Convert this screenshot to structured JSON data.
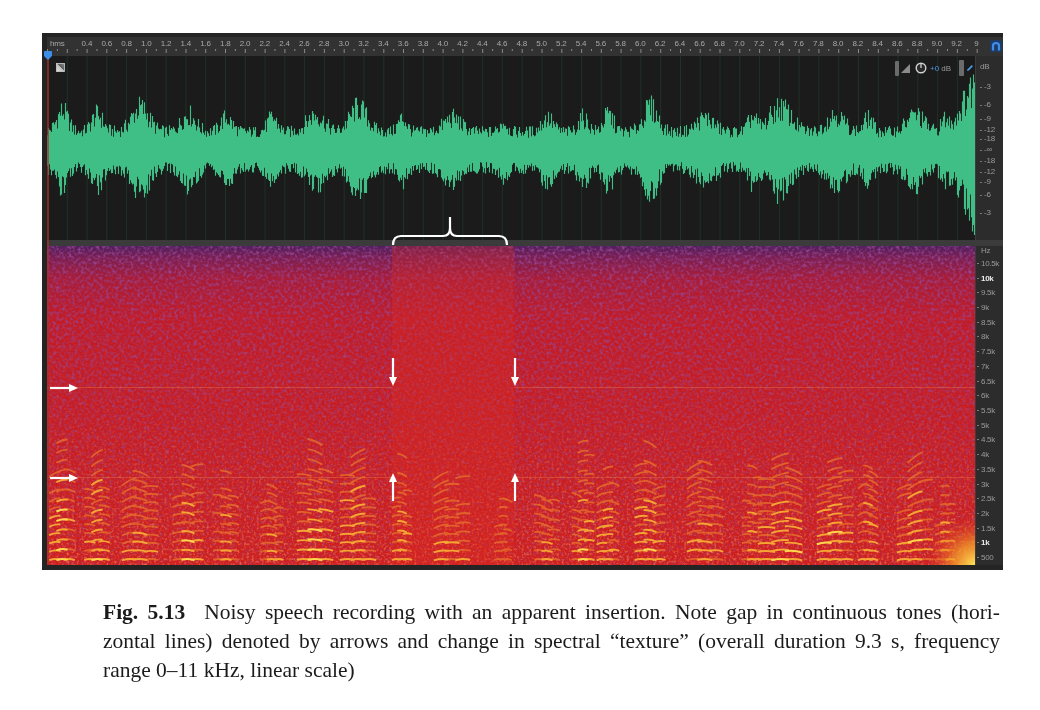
{
  "editor": {
    "time_ruler": {
      "unit_label": "hms",
      "labels": [
        "0.4",
        "0.6",
        "0.8",
        "1.0",
        "1.2",
        "1.4",
        "1.6",
        "1.8",
        "2.0",
        "2.2",
        "2.4",
        "2.6",
        "2.8",
        "3.0",
        "3.2",
        "3.4",
        "3.6",
        "3.8",
        "4.0",
        "4.2",
        "4.4",
        "4.6",
        "4.8",
        "5.0",
        "5.2",
        "5.4",
        "5.6",
        "5.8",
        "6.0",
        "6.2",
        "6.4",
        "6.6",
        "6.8",
        "7.0",
        "7.2",
        "7.4",
        "7.6",
        "7.8",
        "8.0",
        "8.2",
        "8.4",
        "8.6",
        "8.8",
        "9.0",
        "9.2",
        "9"
      ]
    },
    "waveform_panel": {
      "gain_reading": {
        "value": "+0",
        "unit": "dB"
      },
      "level_scale": {
        "unit": "dB",
        "labels": [
          "-3",
          "-6",
          "-9",
          "-12",
          "-18",
          "-∞",
          "-18",
          "-12",
          "-9",
          "-6",
          "-3"
        ]
      }
    },
    "spectrogram_panel": {
      "frequency_scale": {
        "unit": "Hz",
        "labels": [
          {
            "text": "10.5k",
            "major": false
          },
          {
            "text": "10k",
            "major": true
          },
          {
            "text": "9.5k",
            "major": false
          },
          {
            "text": "9k",
            "major": false
          },
          {
            "text": "8.5k",
            "major": false
          },
          {
            "text": "8k",
            "major": false
          },
          {
            "text": "7.5k",
            "major": false
          },
          {
            "text": "7k",
            "major": false
          },
          {
            "text": "6.5k",
            "major": false
          },
          {
            "text": "6k",
            "major": false
          },
          {
            "text": "5.5k",
            "major": false
          },
          {
            "text": "5k",
            "major": false
          },
          {
            "text": "4.5k",
            "major": false
          },
          {
            "text": "4k",
            "major": false
          },
          {
            "text": "3.5k",
            "major": false
          },
          {
            "text": "3k",
            "major": false
          },
          {
            "text": "2.5k",
            "major": false
          },
          {
            "text": "2k",
            "major": false
          },
          {
            "text": "1.5k",
            "major": false
          },
          {
            "text": "1k",
            "major": true
          },
          {
            "text": "500",
            "major": false
          }
        ]
      }
    }
  },
  "caption": {
    "lines": [
      "**Fig. 5.13** Noisy speech recording with an apparent insertion. Note gap in continuous tones (hori-",
      "zontal lines) denoted by arrows and change in spectral “texture” (overall duration 9.3 s, frequency",
      "range 0–11 kHz, linear scale)"
    ]
  }
}
